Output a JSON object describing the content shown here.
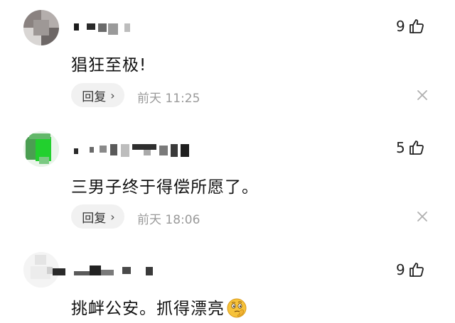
{
  "comments": [
    {
      "text": "猖狂至极!",
      "reply_label": "回复",
      "time": "前天 11:25",
      "likes": "9"
    },
    {
      "text": "三男子终于得偿所愿了。",
      "reply_label": "回复",
      "time": "前天 18:06",
      "likes": "5"
    },
    {
      "text": "挑衅公安。抓得漂亮",
      "likes": "9",
      "emoji": "thinking-face-emoji"
    }
  ],
  "icons": {
    "like": "thumbs-up-icon",
    "close": "close-icon",
    "reply_arrow": "chevron-right-icon"
  },
  "colors": {
    "text": "#111111",
    "time": "#9a9a9a",
    "pill": "#f1f1f1",
    "avatar2": "#2dbd3a"
  }
}
